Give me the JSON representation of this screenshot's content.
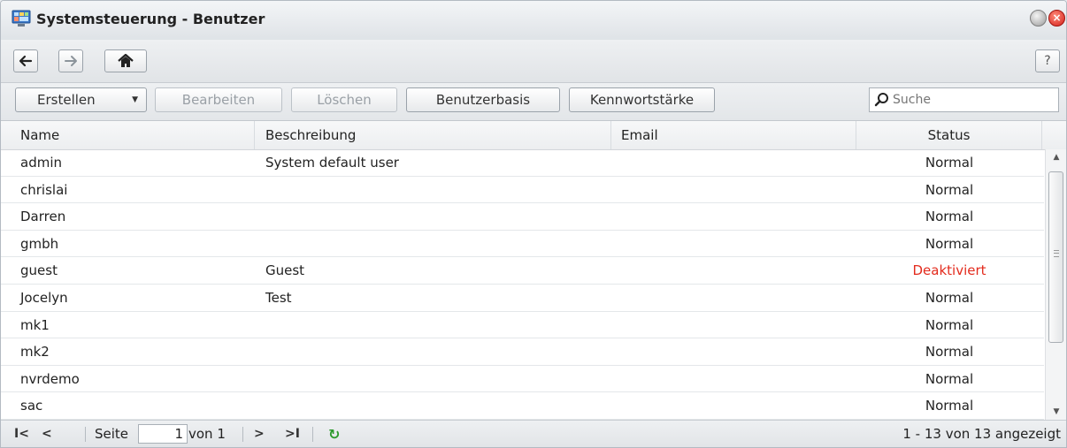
{
  "window": {
    "title": "Systemsteuerung - Benutzer",
    "close_glyph": "×"
  },
  "nav": {
    "help_label": "?",
    "back_icon": "arrow-left-icon",
    "forward_icon": "arrow-right-icon",
    "home_icon": "home-icon"
  },
  "toolbar": {
    "create_label": "Erstellen",
    "edit_label": "Bearbeiten",
    "delete_label": "Löschen",
    "userbase_label": "Benutzerbasis",
    "password_strength_label": "Kennwortstärke",
    "search_placeholder": "Suche"
  },
  "grid": {
    "columns": {
      "name": "Name",
      "description": "Beschreibung",
      "email": "Email",
      "status": "Status"
    },
    "rows": [
      {
        "name": "admin",
        "description": "System default user",
        "email": "",
        "status": "Normal"
      },
      {
        "name": "chrislai",
        "description": "",
        "email": "",
        "status": "Normal"
      },
      {
        "name": "Darren",
        "description": "",
        "email": "",
        "status": "Normal"
      },
      {
        "name": "gmbh",
        "description": "",
        "email": "",
        "status": "Normal"
      },
      {
        "name": "guest",
        "description": "Guest",
        "email": "",
        "status": "Deaktiviert"
      },
      {
        "name": "Jocelyn",
        "description": "Test",
        "email": "",
        "status": "Normal"
      },
      {
        "name": "mk1",
        "description": "",
        "email": "",
        "status": "Normal"
      },
      {
        "name": "mk2",
        "description": "",
        "email": "",
        "status": "Normal"
      },
      {
        "name": "nvrdemo",
        "description": "",
        "email": "",
        "status": "Normal"
      },
      {
        "name": "sac",
        "description": "",
        "email": "",
        "status": "Normal"
      }
    ]
  },
  "pager": {
    "page_label": "Seite",
    "page_value": "1",
    "of_label": "von 1",
    "info": "1 - 13 von 13 angezeigt"
  },
  "colors": {
    "deactivated": "#e32b1d",
    "refresh": "#2e9a2e",
    "close_button": "#d3201a"
  }
}
